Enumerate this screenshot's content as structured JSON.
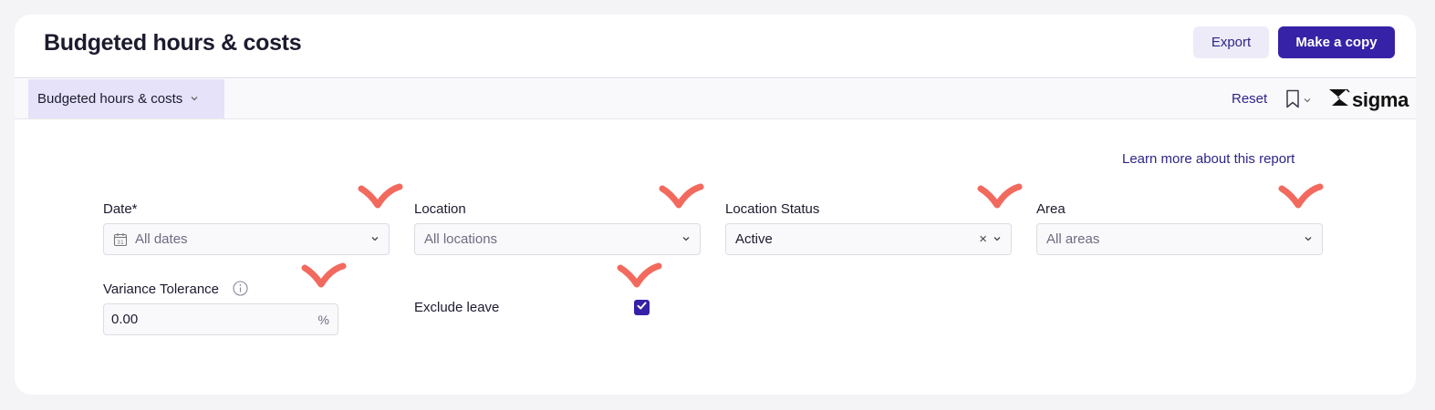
{
  "header": {
    "title": "Budgeted hours & costs",
    "export_label": "Export",
    "copy_label": "Make a copy"
  },
  "toolbar": {
    "workbook_tab": "Budgeted hours & costs",
    "reset_label": "Reset",
    "brand": "sigma"
  },
  "learn_more": "Learn more about this report",
  "filters": {
    "date": {
      "label": "Date*",
      "placeholder": "All dates"
    },
    "location": {
      "label": "Location",
      "placeholder": "All locations"
    },
    "location_status": {
      "label": "Location Status",
      "value": "Active",
      "clear_glyph": "×"
    },
    "area": {
      "label": "Area",
      "placeholder": "All areas"
    },
    "variance": {
      "label": "Variance Tolerance",
      "value": "0.00",
      "unit": "%"
    },
    "exclude_leave": {
      "label": "Exclude leave",
      "checked": true
    }
  },
  "colors": {
    "primary": "#3622a6",
    "link": "#2e2589",
    "secondary_button_bg": "#ecebf7",
    "active_tab_bg": "#e5e2f9",
    "annotation_marks": "#f26a5e"
  },
  "icons": [
    "calendar-icon",
    "chevron-down-icon",
    "clear-icon",
    "info-icon",
    "bookmark-icon",
    "sigma-logo-icon",
    "check-icon"
  ]
}
